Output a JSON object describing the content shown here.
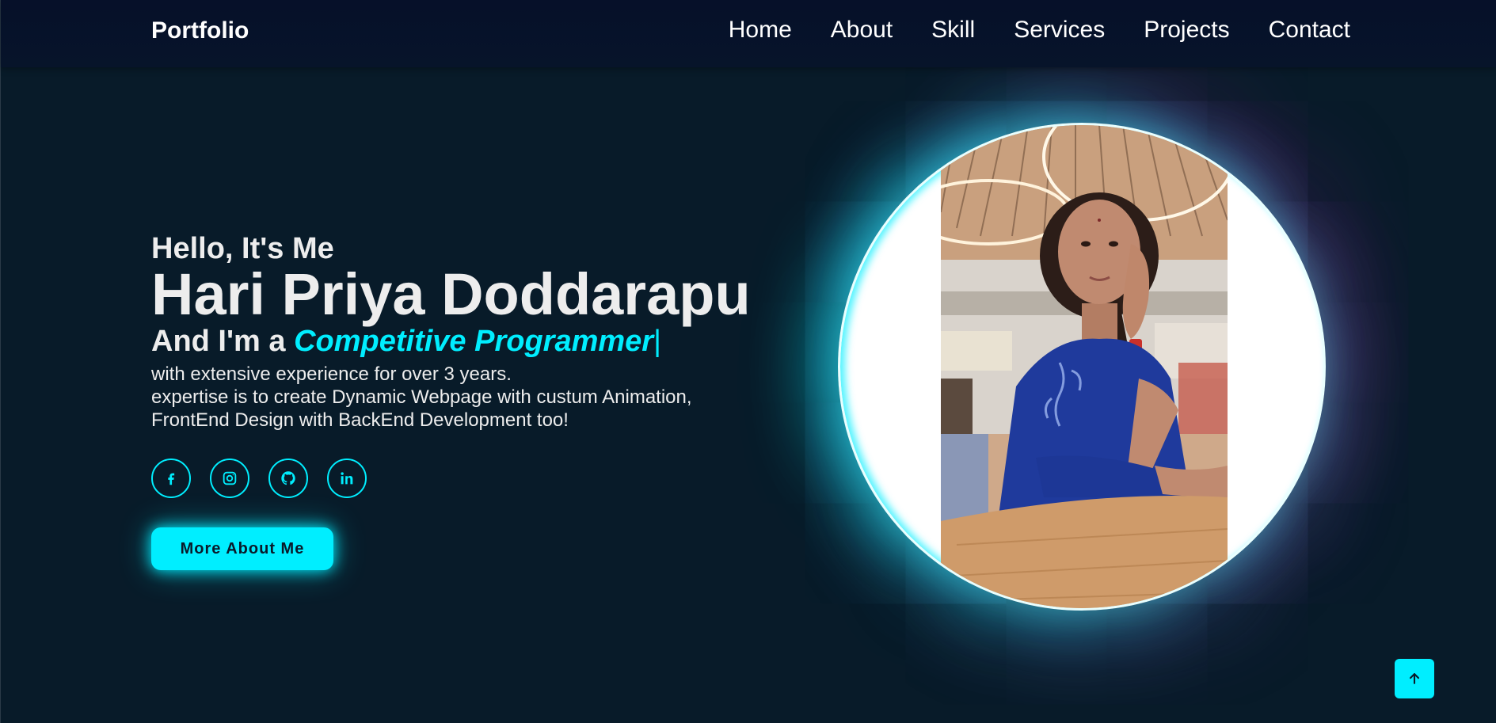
{
  "header": {
    "logo": "Portfolio",
    "nav": [
      "Home",
      "About",
      "Skill",
      "Services",
      "Projects",
      "Contact"
    ]
  },
  "hero": {
    "greeting": "Hello, It's Me",
    "name": "Hari Priya Doddarapu",
    "role_prefix": "And I'm a ",
    "role_typed": "Competitive Programmer",
    "cursor": "|",
    "description": [
      "with extensive experience for over 3 years.",
      "expertise is to create Dynamic Webpage with custum Animation,",
      "FrontEnd Design with BackEnd Development too!"
    ],
    "socials": [
      "facebook-icon",
      "instagram-icon",
      "github-icon",
      "linkedin-icon"
    ],
    "button_label": "More About Me"
  },
  "colors": {
    "accent": "#00eeff",
    "background": "#081b29",
    "header": "#061029",
    "text": "#ededed"
  },
  "scroll_top_icon": "arrow-up-icon"
}
